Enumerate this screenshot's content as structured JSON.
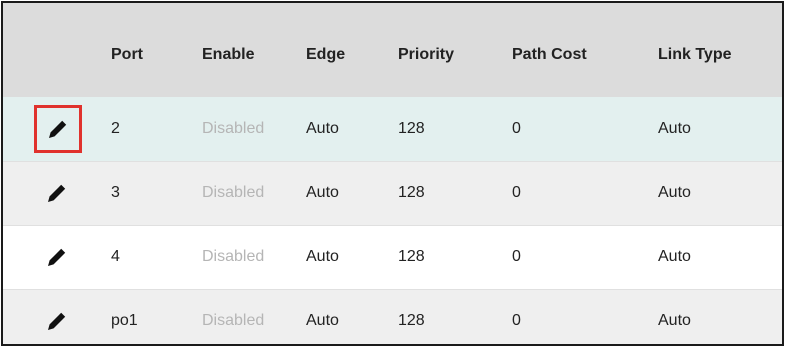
{
  "table": {
    "headers": {
      "edit": "",
      "port": "Port",
      "enable": "Enable",
      "edge": "Edge",
      "priority": "Priority",
      "path_cost": "Path Cost",
      "link_type": "Link Type"
    },
    "rows": [
      {
        "port": "2",
        "enable": "Disabled",
        "edge": "Auto",
        "priority": "128",
        "path_cost": "0",
        "link_type": "Auto"
      },
      {
        "port": "3",
        "enable": "Disabled",
        "edge": "Auto",
        "priority": "128",
        "path_cost": "0",
        "link_type": "Auto"
      },
      {
        "port": "4",
        "enable": "Disabled",
        "edge": "Auto",
        "priority": "128",
        "path_cost": "0",
        "link_type": "Auto"
      },
      {
        "port": "po1",
        "enable": "Disabled",
        "edge": "Auto",
        "priority": "128",
        "path_cost": "0",
        "link_type": "Auto"
      }
    ]
  },
  "icons": {
    "edit": "pencil-icon"
  },
  "colors": {
    "header_bg": "#dcdcdc",
    "selected_row_bg": "#e3f0ef",
    "alt_row_bg": "#efefef",
    "disabled_text": "#b5b5b5",
    "highlight_border": "#e0322d"
  }
}
